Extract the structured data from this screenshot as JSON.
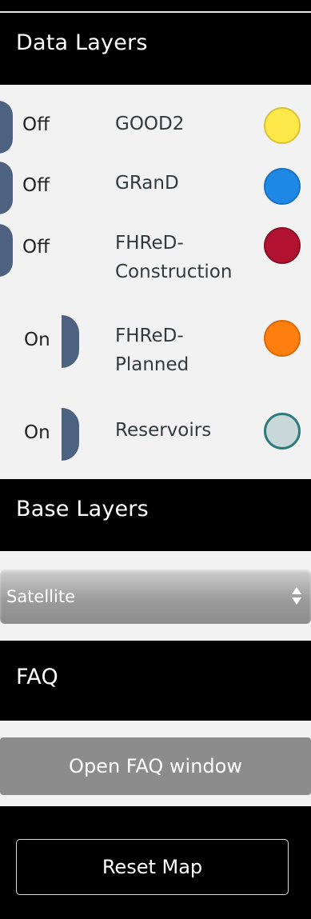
{
  "data_layers": {
    "title": "Data Layers",
    "items": [
      {
        "toggle": "Off",
        "name": "GOOD2",
        "color": "#fde84a"
      },
      {
        "toggle": "Off",
        "name": "GRanD",
        "color": "#1e88e5"
      },
      {
        "toggle": "Off",
        "name": "FHReD-\nConstruction",
        "color": "#b0122f"
      },
      {
        "toggle": "On",
        "name": "FHReD-\nPlanned",
        "color": "#ff7f0e"
      },
      {
        "toggle": "On",
        "name": "Reservoirs",
        "color": "#c8d8d8"
      }
    ]
  },
  "base_layers": {
    "title": "Base Layers",
    "selected": "Satellite"
  },
  "faq": {
    "title": "FAQ",
    "button_label": "Open FAQ window"
  },
  "reset": {
    "button_label": "Reset Map"
  }
}
